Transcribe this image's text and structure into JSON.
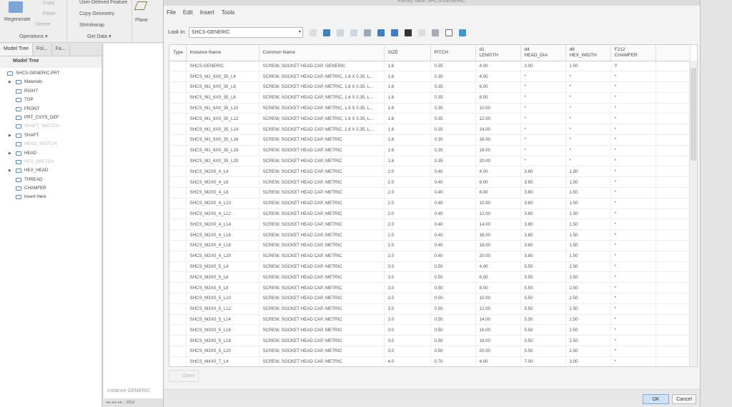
{
  "ribbon": {
    "regenerate": "Regenerate",
    "copy": "Copy",
    "paste": "Paste",
    "delete": "Delete",
    "udf": "User-Defined Feature",
    "copy_geometry": "Copy Geometry",
    "shrinkwrap": "Shrinkwrap",
    "plane": "Plane",
    "operations": "Operations ▾",
    "get_data": "Get Data ▾"
  },
  "tree": {
    "tabs": [
      "Model Tree",
      "Fol...",
      "Fa..."
    ],
    "header": "Model Tree",
    "items": [
      {
        "label": "SHCS-GENERIC.PRT",
        "level": 0,
        "expand": false,
        "dim": false
      },
      {
        "label": "Materials",
        "level": 1,
        "expand": true,
        "dim": false
      },
      {
        "label": "RIGHT",
        "level": 1,
        "expand": false,
        "dim": false
      },
      {
        "label": "TOP",
        "level": 1,
        "expand": false,
        "dim": false
      },
      {
        "label": "FRONT",
        "level": 1,
        "expand": false,
        "dim": false
      },
      {
        "label": "PRT_CSYS_DEF",
        "level": 1,
        "expand": false,
        "dim": false
      },
      {
        "label": "SHAFT_SKETCH",
        "level": 1,
        "expand": false,
        "dim": true
      },
      {
        "label": "SHAFT",
        "level": 1,
        "expand": true,
        "dim": false
      },
      {
        "label": "HEAD_SKETCH",
        "level": 1,
        "expand": false,
        "dim": true
      },
      {
        "label": "HEAD",
        "level": 1,
        "expand": true,
        "dim": false
      },
      {
        "label": "HEX_SKETCH",
        "level": 1,
        "expand": false,
        "dim": true
      },
      {
        "label": "HEX_HEAD",
        "level": 1,
        "expand": true,
        "dim": false
      },
      {
        "label": "THREAD",
        "level": 1,
        "expand": false,
        "dim": false
      },
      {
        "label": "CHAMFER",
        "level": 1,
        "expand": false,
        "dim": false
      },
      {
        "label": "Insert Here",
        "level": 1,
        "expand": false,
        "dim": false
      }
    ],
    "instance_label": "Instance GENERIC",
    "nav": "◂◂ ◂ ▸ ▸▸ ▫ Mbd"
  },
  "dialog": {
    "title": "Family Table SHCS-GENERIC",
    "menu": [
      "File",
      "Edit",
      "Insert",
      "Tools"
    ],
    "look_in_label": "Look In:",
    "look_in_value": "SHCS-GENERIC",
    "columns": [
      "Type",
      "Instance Name",
      "Common Name",
      "SIZE",
      "PITCH",
      "d1\nLENGTH",
      "d4\nHEAD_DIA",
      "d8\nHEX_WIDTH",
      "F212\nCHAMFER",
      ""
    ],
    "rows": [
      [
        "",
        "SHCS-GENERIC",
        "SCREW, SOCKET HEAD CAP, GENERIC",
        "1.6",
        "0.35",
        "4.00",
        "3.00",
        "1.50",
        "Y"
      ],
      [
        "",
        "SHCS_M1_6X0_35_L4",
        "SCREW, SOCKET HEAD CAP, METRIC, 1.6 X 0.35, L...",
        "1.6",
        "0.35",
        "4.00",
        "*",
        "*",
        "*"
      ],
      [
        "",
        "SHCS_M1_6X0_35_L6",
        "SCREW, SOCKET HEAD CAP, METRIC, 1.6 X 0.35, L...",
        "1.6",
        "0.35",
        "6.00",
        "*",
        "*",
        "*"
      ],
      [
        "",
        "SHCS_M1_6X0_35_L8",
        "SCREW, SOCKET HEAD CAP, METRIC, 1.6 X 0.35, L...",
        "1.6",
        "0.35",
        "8.00",
        "*",
        "*",
        "*"
      ],
      [
        "",
        "SHCS_M1_6X0_35_L10",
        "SCREW, SOCKET HEAD CAP, METRIC, 1.6 X 0.35, L...",
        "1.6",
        "0.35",
        "10.00",
        "*",
        "*",
        "*"
      ],
      [
        "",
        "SHCS_M1_6X0_35_L12",
        "SCREW, SOCKET HEAD CAP, METRIC, 1.6 X 0.35, L...",
        "1.6",
        "0.35",
        "12.00",
        "*",
        "*",
        "*"
      ],
      [
        "",
        "SHCS_M1_6X0_35_L14",
        "SCREW, SOCKET HEAD CAP, METRIC, 1.6 X 0.35, L...",
        "1.6",
        "0.35",
        "14.00",
        "*",
        "*",
        "*"
      ],
      [
        "",
        "SHCS_M1_6X0_35_L16",
        "SCREW, SOCKET HEAD CAP, METRIC",
        "1.6",
        "0.35",
        "16.00",
        "*",
        "*",
        "*"
      ],
      [
        "",
        "SHCS_M1_6X0_35_L18",
        "SCREW, SOCKET HEAD CAP, METRIC",
        "1.6",
        "0.35",
        "18.00",
        "*",
        "*",
        "*"
      ],
      [
        "",
        "SHCS_M1_6X0_35_L20",
        "SCREW, SOCKET HEAD CAP, METRIC",
        "1.6",
        "0.35",
        "20.00",
        "*",
        "*",
        "*"
      ],
      [
        "",
        "SHCS_M2X0_4_L4",
        "SCREW, SOCKET HEAD CAP, METRIC",
        "2.0",
        "0.40",
        "4.00",
        "3.80",
        "1.50",
        "*"
      ],
      [
        "",
        "SHCS_M2X0_4_L6",
        "SCREW, SOCKET HEAD CAP, METRIC",
        "2.0",
        "0.40",
        "6.00",
        "3.80",
        "1.50",
        "*"
      ],
      [
        "",
        "SHCS_M2X0_4_L8",
        "SCREW, SOCKET HEAD CAP, METRIC",
        "2.0",
        "0.40",
        "8.00",
        "3.80",
        "1.50",
        "*"
      ],
      [
        "",
        "SHCS_M2X0_4_L10",
        "SCREW, SOCKET HEAD CAP, METRIC",
        "2.0",
        "0.40",
        "10.00",
        "3.80",
        "1.50",
        "*"
      ],
      [
        "",
        "SHCS_M2X0_4_L12",
        "SCREW, SOCKET HEAD CAP, METRIC",
        "2.0",
        "0.40",
        "12.00",
        "3.80",
        "1.50",
        "*"
      ],
      [
        "",
        "SHCS_M2X0_4_L14",
        "SCREW, SOCKET HEAD CAP, METRIC",
        "2.0",
        "0.40",
        "14.00",
        "3.80",
        "1.50",
        "*"
      ],
      [
        "",
        "SHCS_M2X0_4_L16",
        "SCREW, SOCKET HEAD CAP, METRIC",
        "2.0",
        "0.40",
        "16.00",
        "3.80",
        "1.50",
        "*"
      ],
      [
        "",
        "SHCS_M2X0_4_L18",
        "SCREW, SOCKET HEAD CAP, METRIC",
        "2.0",
        "0.40",
        "18.00",
        "3.80",
        "1.50",
        "*"
      ],
      [
        "",
        "SHCS_M2X0_4_L20",
        "SCREW, SOCKET HEAD CAP, METRIC",
        "2.0",
        "0.40",
        "20.00",
        "3.80",
        "1.50",
        "*"
      ],
      [
        "",
        "SHCS_M3X0_5_L4",
        "SCREW, SOCKET HEAD CAP, METRIC",
        "3.0",
        "0.50",
        "4.00",
        "5.50",
        "2.50",
        "*"
      ],
      [
        "",
        "SHCS_M3X0_5_L6",
        "SCREW, SOCKET HEAD CAP, METRIC",
        "3.0",
        "0.50",
        "6.00",
        "5.50",
        "2.50",
        "*"
      ],
      [
        "",
        "SHCS_M3X0_5_L8",
        "SCREW, SOCKET HEAD CAP, METRIC",
        "3.0",
        "0.50",
        "8.00",
        "5.50",
        "2.50",
        "*"
      ],
      [
        "",
        "SHCS_M3X0_5_L10",
        "SCREW, SOCKET HEAD CAP, METRIC",
        "3.0",
        "0.50",
        "10.00",
        "5.50",
        "2.50",
        "*"
      ],
      [
        "",
        "SHCS_M3X0_5_L12",
        "SCREW, SOCKET HEAD CAP, METRIC",
        "3.0",
        "0.50",
        "12.00",
        "5.50",
        "2.50",
        "*"
      ],
      [
        "",
        "SHCS_M3X0_5_L14",
        "SCREW, SOCKET HEAD CAP, METRIC",
        "3.0",
        "0.50",
        "14.00",
        "5.50",
        "2.50",
        "*"
      ],
      [
        "",
        "SHCS_M3X0_5_L16",
        "SCREW, SOCKET HEAD CAP, METRIC",
        "3.0",
        "0.50",
        "16.00",
        "5.50",
        "2.50",
        "*"
      ],
      [
        "",
        "SHCS_M3X0_5_L18",
        "SCREW, SOCKET HEAD CAP, METRIC",
        "3.0",
        "0.50",
        "18.00",
        "5.50",
        "2.50",
        "*"
      ],
      [
        "",
        "SHCS_M3X0_5_L20",
        "SCREW, SOCKET HEAD CAP, METRIC",
        "3.0",
        "0.50",
        "20.00",
        "5.50",
        "2.50",
        "*"
      ],
      [
        "",
        "SHCS_M4X0_7_L4",
        "SCREW, SOCKET HEAD CAP, METRIC",
        "4.0",
        "0.70",
        "4.00",
        "7.00",
        "3.00",
        "*"
      ]
    ],
    "open": "Open",
    "ok": "OK",
    "cancel": "Cancel"
  }
}
